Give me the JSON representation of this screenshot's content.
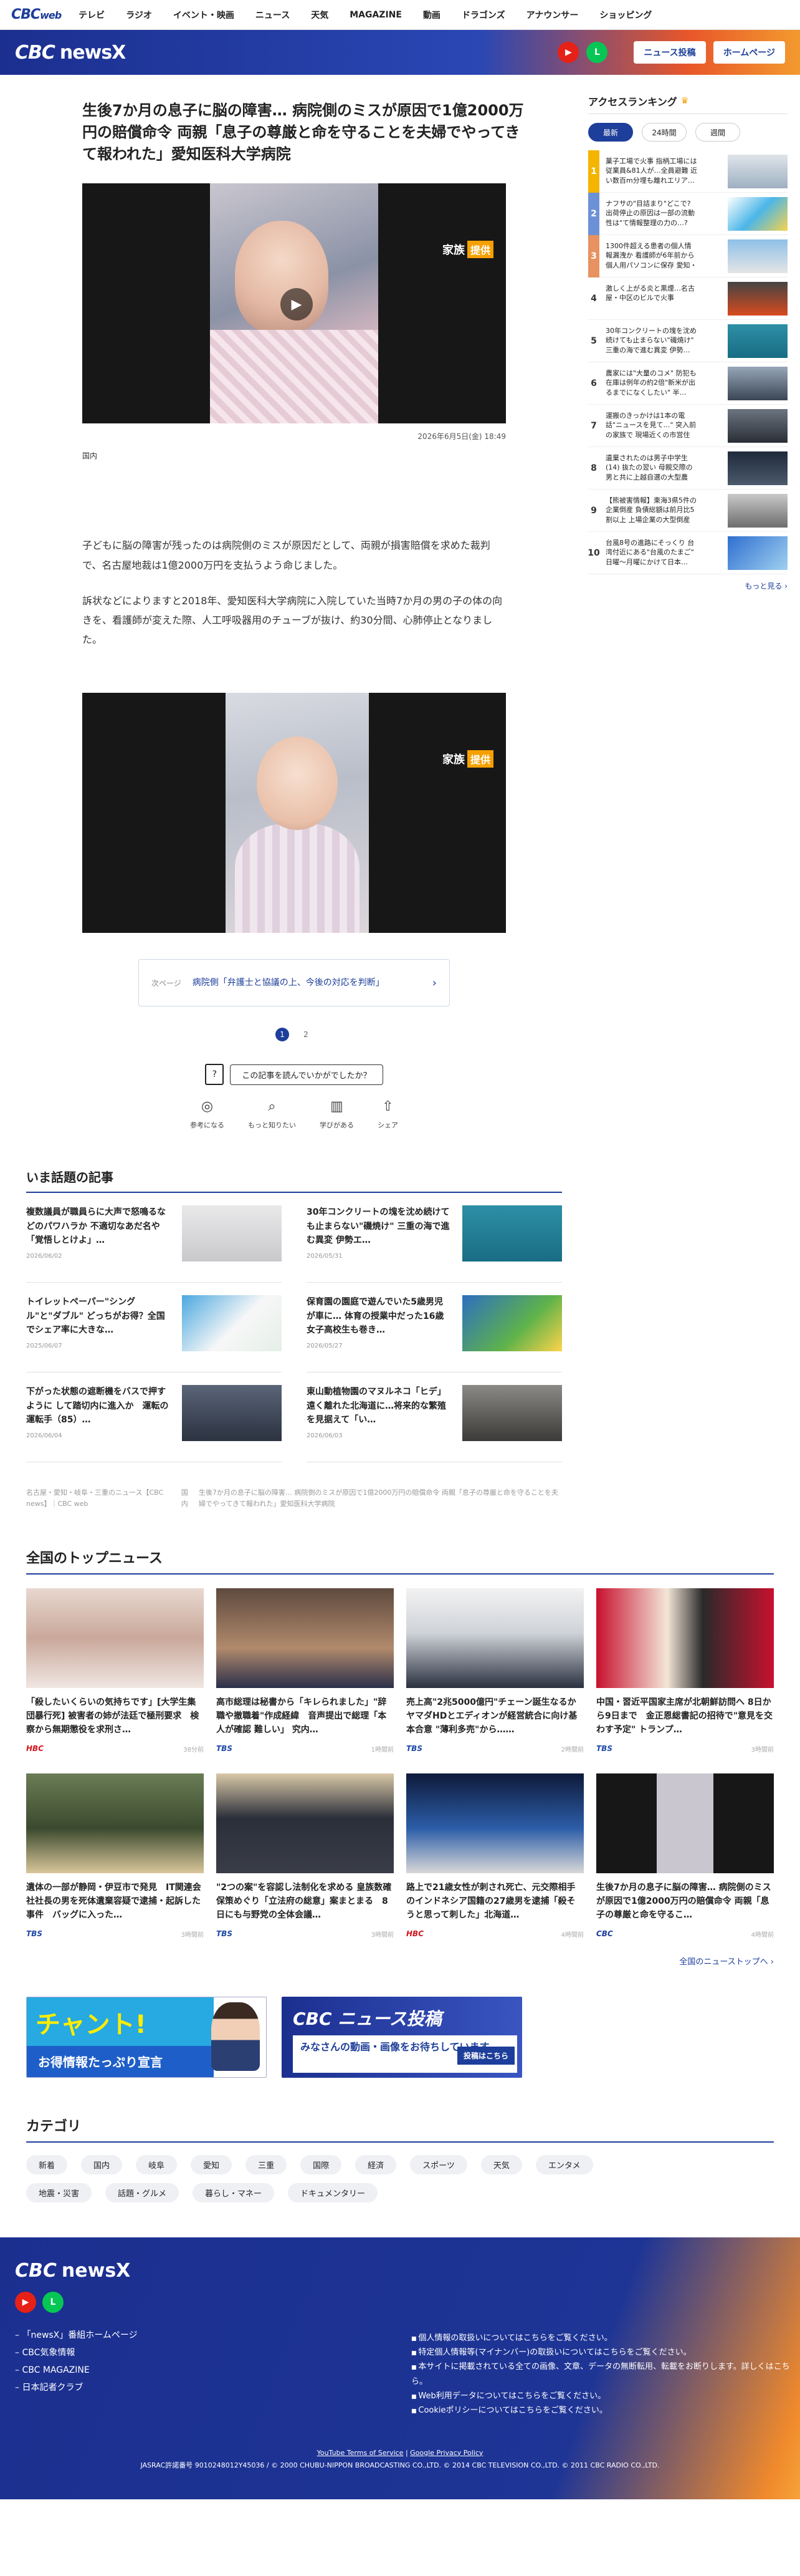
{
  "topnav": {
    "logo": "CBC",
    "logo_web": "web",
    "items": [
      "テレビ",
      "ラジオ",
      "イベント・映画",
      "ニュース",
      "天気",
      "MAGAZINE",
      "動画",
      "ドラゴンズ",
      "アナウンサー",
      "ショッピング"
    ]
  },
  "brand": {
    "logo": "CBC",
    "news": "newsX",
    "youtube_icon": "youtube-icon",
    "line_icon": "line-icon",
    "btn_post": "ニュース投稿",
    "btn_home": "ホームページ"
  },
  "article": {
    "title": "生後7か月の息子に脳の障害… 病院側のミスが原因で1億2000万円の賠償命令 両親「息子の尊厳と命を守ることを夫婦でやってきて報われた」愛知医科大学病院",
    "video_caption": "家族",
    "video_tag": "提供",
    "date": "2026年6月5日(金) 18:49",
    "category": "国内",
    "paragraphs": [
      "子どもに脳の障害が残ったのは病院側のミスが原因だとして、両親が損害賠償を求めた裁判で、名古屋地裁は1億2000万円を支払うよう命じました。",
      "訴状などによりますと2018年、愛知医科大学病院に入院していた当時7か月の男の子の体の向きを、看護師が変えた際、人工呼吸器用のチューブが抜け、約30分間、心肺停止となりました。"
    ],
    "photo2_caption": "家族",
    "photo2_tag": "提供",
    "next_label": "次ページ",
    "next_text": "病院側「弁護士と協議の上、今後の対応を判断」",
    "pages": [
      "1",
      "2"
    ],
    "feedback_prompt": "この記事を読んでいかがでしたか？",
    "reactions": [
      "参考になる",
      "もっと知りたい",
      "学びがある",
      "シェア"
    ]
  },
  "topics": {
    "title": "いま話題の記事",
    "items": [
      {
        "headline": "複数議員が職員らに大声で怒鳴るなどのパワハラか 不適切なあだ名や「覚悟しとけよ」…",
        "date": "2026/06/02"
      },
      {
        "headline": "30年コンクリートの塊を沈め続けても止まらない\"磯焼け\" 三重の海で進む異変 伊勢エ…",
        "date": "2026/05/31"
      },
      {
        "headline": "トイレットペーパー\"シングル\"と\"ダブル\" どっちがお得？全国でシェア率に大きな…",
        "date": "2025/06/07"
      },
      {
        "headline": "保育園の園庭で遊んでいた5歳男児が車に… 体育の授業中だった16歳女子高校生も巻き…",
        "date": "2026/05/27"
      },
      {
        "headline": "下がった状態の遮断機をバスで押すように して踏切内に進入か　運転の運転手（85）…",
        "date": "2026/06/04"
      },
      {
        "headline": "東山動植物園のマヌルネコ「ヒデ」遠く離れた北海道に…将来的な繁殖を見据えて「い…",
        "date": "2026/06/03"
      }
    ]
  },
  "breadcrumb": [
    "名古屋・愛知・岐阜・三重のニュース【CBC news】｜CBC web",
    "国内",
    "生後7か月の息子に脳の障害… 病院側のミスが原因で1億2000万円の賠償命令 両親「息子の尊厳と命を守ることを夫婦でやってきて報われた」愛知医科大学病院"
  ],
  "top_news": {
    "title": "全国のトップニュース",
    "items": [
      {
        "headline": "「殺したいくらいの気持ちです」[大学生集団暴行死] 被害者の姉が法廷で極刑要求　検察から無期懲役を求刑さ…",
        "source": "HBC",
        "date": "38分前"
      },
      {
        "headline": "高市総理は秘書から「キレられました」\"辞職や撤職着\"作成経緯　音声提出で総理「本人が確認 難しい」 究内…",
        "source": "TBS",
        "date": "1時間前"
      },
      {
        "headline": "売上高\"2兆5000億円\"チェーン誕生なるか　ヤマダHDとエディオンが経営統合に向け基本合意 \"薄利多売\"から……",
        "source": "TBS",
        "date": "2時間前"
      },
      {
        "headline": "中国・習近平国家主席が北朝鮮訪問へ 8日から9日まで　金正恩総書記の招待で\"意見を交わす予定\" トランプ…",
        "source": "TBS",
        "date": "3時間前"
      },
      {
        "headline": "遺体の一部が静岡・伊豆市で発見　IT関連会社社長の男を死体遺棄容疑で逮捕・起訴した事件　バッグに入った…",
        "source": "TBS",
        "date": "3時間前"
      },
      {
        "headline": "\"2つの案\"を容認し法制化を求める 皇族数確保策めぐり「立法府の総意」案まとまる　8日にも与野党の全体会議…",
        "source": "TBS",
        "date": "3時間前"
      },
      {
        "headline": "路上で21歳女性が刺され死亡、元交際相手のインドネシア国籍の27歳男を逮捕「殺そうと思って刺した」北海道…",
        "source": "HBC",
        "date": "4時間前"
      },
      {
        "headline": "生後7か月の息子に脳の障害… 病院側のミスが原因で1億2000万円の賠償命令 両親「息子の尊厳と命を守るこ…",
        "source": "CBC",
        "date": "4時間前"
      }
    ],
    "more": "全国のニューストップへ ›"
  },
  "banners": {
    "chant_title": "チャント!",
    "chant_sub": "お得情報たっぷり宣言",
    "post_title": "CBC ニュース投稿",
    "post_body": "みなさんの動画・画像をお待ちしています。",
    "post_btn": "投稿はこちら"
  },
  "categories": {
    "title": "カテゴリ",
    "items": [
      "新着",
      "国内",
      "岐阜",
      "愛知",
      "三重",
      "国際",
      "経済",
      "スポーツ",
      "天気",
      "エンタメ",
      "地震・災害",
      "話題・グルメ",
      "暮らし・マネー",
      "ドキュメンタリー"
    ]
  },
  "footer": {
    "logo": "CBC",
    "news": "newsX",
    "links": [
      "「newsX」番組ホームページ",
      "CBC気象情報",
      "CBC MAGAZINE",
      "日本記者クラブ"
    ],
    "right_links": [
      "個人情報の取扱いについてはこちらをご覧ください。",
      "特定個人情報等(マイナンバー)の取扱いについてはこちらをご覧ください。",
      "本サイトに掲載されている全ての画像、文章、データの無断転用、転載をお断りします。詳しくはこちら。",
      "Web利用データについてはこちらをご覧ください。",
      "Cookieポリシーについてはこちらをご覧ください。"
    ],
    "terms": "YouTube Terms of Service",
    "privacy": "Google Privacy Policy",
    "copyright": "JASRAC許諾番号 9010248012Y45036 / © 2000 CHUBU-NIPPON BROADCASTING CO.,LTD. © 2014 CBC TELEVISION CO.,LTD. © 2011 CBC RADIO CO.,LTD."
  },
  "ranking": {
    "title": "アクセスランキング",
    "tabs": [
      "最新",
      "24時間",
      "週間"
    ],
    "items": [
      {
        "n": "1",
        "text": "菓子工場で火事 指柄工場には従業員&81人が…全員避難 近い数百m分埋も離れエリア…"
      },
      {
        "n": "2",
        "text": "ナフサの\"目詰まり\"どこで? 出荷停止の原因は一部の流動性は\"て情報整理の力の…?"
      },
      {
        "n": "3",
        "text": "1300件超える患者の個人情報漏洩か 看護師が6年前から個人用パソコンに保存 愛知・豊…"
      },
      {
        "n": "4",
        "text": "激しく上がる炎と黒煙…名古屋・中区のビルで火事"
      },
      {
        "n": "5",
        "text": "30年コンクリートの塊を沈め続けても止まらない\"磯焼け\" 三重の海で進む異変 伊勢…"
      },
      {
        "n": "6",
        "text": "農家には\"大量のコメ\" 防犯も在庫は例年の約2倍\"新米が出るまでになくしたい\" 半…"
      },
      {
        "n": "7",
        "text": "運搬のきっかけは1本の電話\"ニュースを見て…\" 突入前の家族で 現場近くの市営住宅…"
      },
      {
        "n": "8",
        "text": "遺棄されたのは男子中学生(14) 抜たの翌い 母親交際の男と共に上越自選の大型農家…"
      },
      {
        "n": "9",
        "text": "【熊被害情報】東海3県5件の企業倒産 負債総額は前月比5割以上 上場企業の大型倒産が…"
      },
      {
        "n": "10",
        "text": "台風8号の進路にそっくり 台湾付近にある\"台風のたまご\" 日曜～月曜にかけて日本…"
      }
    ],
    "more": "もっと見る ›"
  },
  "colors": {
    "accent": "#1d3e9a",
    "orange": "#f08a2c",
    "brand_gradient_start": "#1b2f8f"
  }
}
